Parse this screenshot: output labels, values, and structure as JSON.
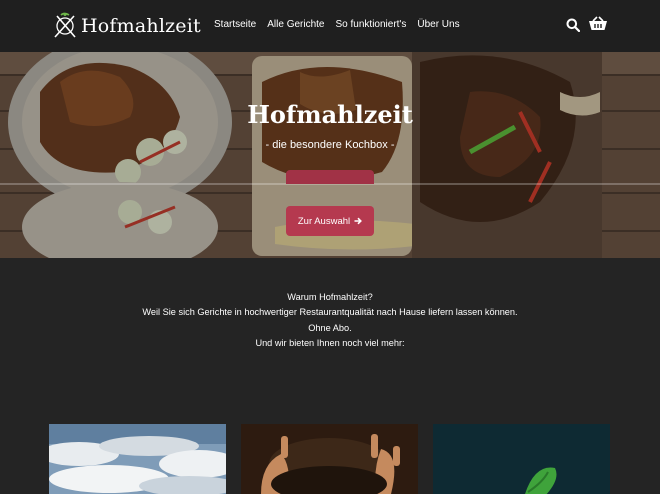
{
  "brand": {
    "name": "Hofmahlzeit"
  },
  "nav": {
    "items": [
      "Startseite",
      "Alle Gerichte",
      "So funktioniert's",
      "Über Uns"
    ]
  },
  "header_icons": [
    "search-icon",
    "cart-icon"
  ],
  "hero": {
    "title": "Hofmahlzeit",
    "subtitle": "- die besondere Kochbox -",
    "button_label": "Zur Auswahl",
    "button_icon": "arrow-right-icon",
    "button_color": "#b5394f"
  },
  "intro": {
    "lines": [
      "Warum Hofmahlzeit?",
      "Weil Sie sich Gerichte in hochwertiger Restaurantqualität nach Hause liefern lassen können.",
      "Ohne Abo.",
      "Und wir bieten Ihnen noch viel mehr:"
    ]
  },
  "cards": [
    {
      "image": "sky-clouds-image"
    },
    {
      "image": "hands-soil-image"
    },
    {
      "image": "green-leaf-image"
    }
  ],
  "colors": {
    "header_bg": "#1f1f1f",
    "page_bg": "#242424",
    "accent": "#b5394f"
  }
}
